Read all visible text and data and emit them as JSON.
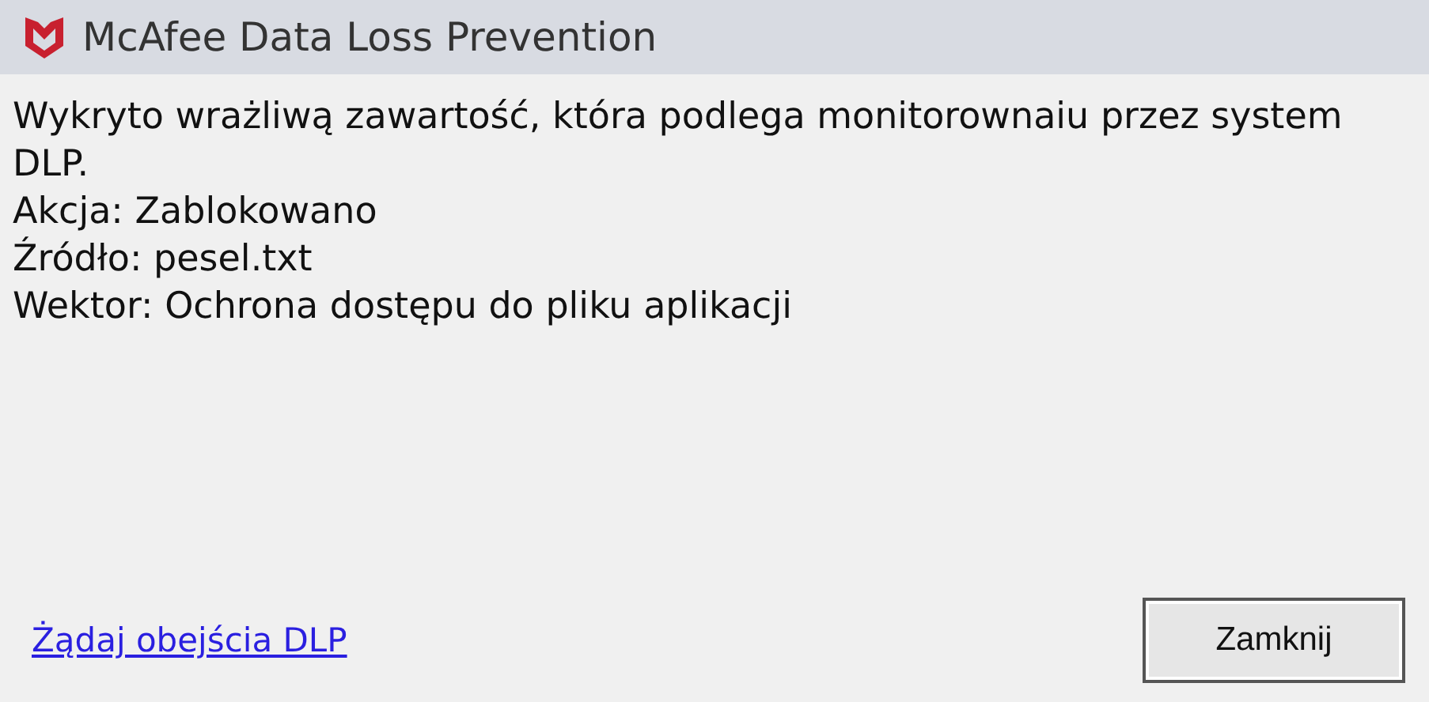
{
  "window": {
    "title": "McAfee Data Loss Prevention"
  },
  "message": "Wykryto wrażliwą zawartość, która podlega monitorownaiu przez system DLP.",
  "details": [
    "Akcja: Zablokowano",
    "Źródło: pesel.txt",
    "Wektor: Ochrona dostępu do pliku aplikacji"
  ],
  "link": "Żądaj obejścia DLP",
  "buttons": [
    "Zamknij"
  ]
}
